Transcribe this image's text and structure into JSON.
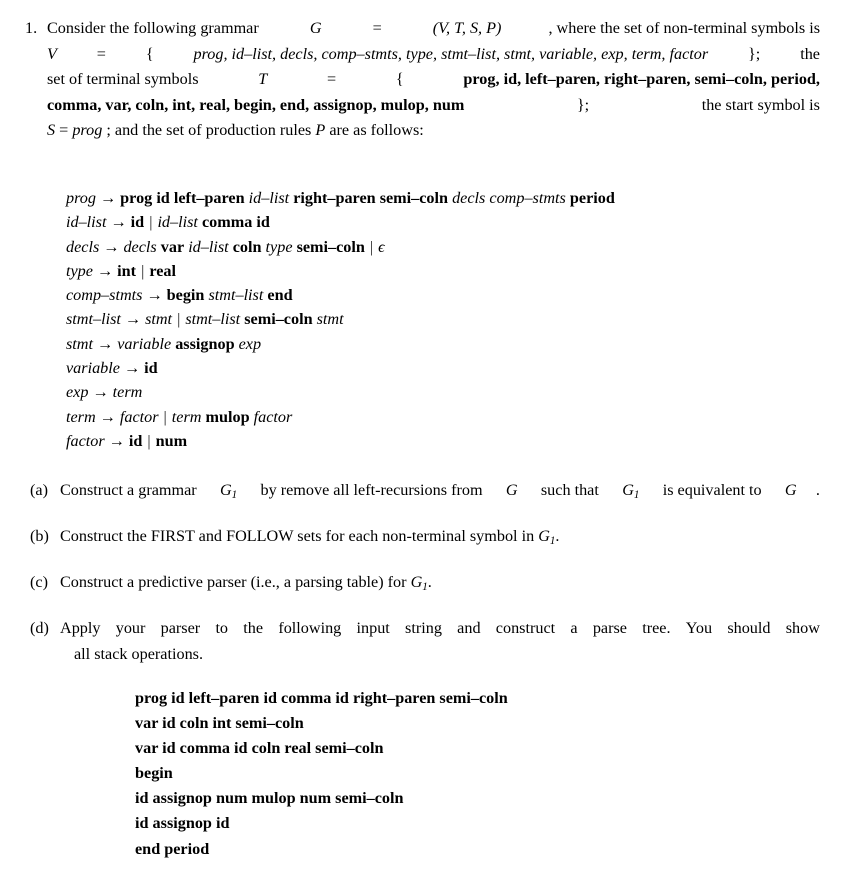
{
  "document": {
    "type": "homework-problem",
    "background_color": "#ffffff",
    "text_color": "#000000"
  },
  "problem": {
    "number": "1.",
    "intro_lines": [
      {
        "segments": [
          "Consider the following grammar ",
          "G",
          " = ",
          "(V, T, S, P)",
          ", where the set of non-terminal symbols is"
        ],
        "plain": "Consider the following grammar G = (V,T,S,P), where the set of non-terminal symbols is"
      },
      {
        "plain": "V = {prog, id_list, decls, comp_stmts, type, stmt_list, stmt, variable, exp, term, factor};  the"
      },
      {
        "plain": "set of terminal symbols T = { prog, id, left_paren, right_paren, semi_coln, period,"
      },
      {
        "plain": "comma, var, coln, int, real, begin, end, assignop, mulop, num }; the start symbol is"
      },
      {
        "plain": "S = prog; and the set of production rules P are as follows:"
      }
    ],
    "line1": {
      "a": "Consider the following grammar ",
      "G": "G",
      "eq": " = ",
      "tuple": "(V, T, S, P)",
      "b": ", where the set of non-terminal symbols is"
    },
    "line2": {
      "V": "V",
      "eq": "=",
      "open": "{",
      "nonterminals": [
        "prog",
        "id–list",
        "decls",
        "comp–stmts",
        "type",
        "stmt–list",
        "stmt",
        "variable",
        "exp",
        "term",
        "factor"
      ],
      "close": "};",
      "tail": "the"
    },
    "line3": {
      "lead": "set of terminal symbols ",
      "T": "T",
      "eq": " = ",
      "open": "{ ",
      "terminals_part1": "prog, id, left–paren, right–paren, semi–coln, period,"
    },
    "line4": {
      "terminals_part2": "comma, var, coln, int, real, begin, end, assignop, mulop, num",
      "close": " };",
      "tail": " the start symbol is"
    },
    "line5": {
      "S": "S",
      "eq": " = ",
      "prog": "prog",
      "tail": "; and the set of production rules ",
      "P": "P",
      "end": " are as follows:"
    }
  },
  "terminal_symbols": [
    "prog",
    "id",
    "left_paren",
    "right_paren",
    "semi_coln",
    "period",
    "comma",
    "var",
    "coln",
    "int",
    "real",
    "begin",
    "end",
    "assignop",
    "mulop",
    "num"
  ],
  "nonterminal_symbols": [
    "prog",
    "id_list",
    "decls",
    "comp_stmts",
    "type",
    "stmt_list",
    "stmt",
    "variable",
    "exp",
    "term",
    "factor"
  ],
  "start_symbol": "prog",
  "productions": [
    {
      "lhs": "prog",
      "arrow": "→",
      "rhs_plain": "prog id left_paren id_list right_paren semi_coln decls comp_stmts period",
      "tokens": [
        {
          "t": "prog",
          "k": "terminal"
        },
        {
          "t": "id",
          "k": "terminal"
        },
        {
          "t": "left–paren",
          "k": "terminal"
        },
        {
          "t": "id–list",
          "k": "nonterminal"
        },
        {
          "t": "right–paren",
          "k": "terminal"
        },
        {
          "t": "semi–coln",
          "k": "terminal"
        },
        {
          "t": "decls",
          "k": "nonterminal"
        },
        {
          "t": "comp–stmts",
          "k": "nonterminal"
        },
        {
          "t": "period",
          "k": "terminal"
        }
      ]
    },
    {
      "lhs": "id_list",
      "arrow": "→",
      "rhs_plain": "id | id_list comma id",
      "tokens": [
        {
          "t": "id",
          "k": "terminal"
        },
        {
          "t": "|",
          "k": "alt"
        },
        {
          "t": "id–list",
          "k": "nonterminal"
        },
        {
          "t": "comma",
          "k": "terminal"
        },
        {
          "t": "id",
          "k": "terminal"
        }
      ]
    },
    {
      "lhs": "decls",
      "arrow": "→",
      "rhs_plain": "decls var id_list coln type semi_coln | ϵ",
      "tokens": [
        {
          "t": "decls",
          "k": "nonterminal"
        },
        {
          "t": "var",
          "k": "terminal"
        },
        {
          "t": "id–list",
          "k": "nonterminal"
        },
        {
          "t": "coln",
          "k": "terminal"
        },
        {
          "t": "type",
          "k": "nonterminal"
        },
        {
          "t": "semi–coln",
          "k": "terminal"
        },
        {
          "t": "|",
          "k": "alt"
        },
        {
          "t": "ϵ",
          "k": "epsilon"
        }
      ]
    },
    {
      "lhs": "type",
      "arrow": "→",
      "rhs_plain": "int | real",
      "tokens": [
        {
          "t": "int",
          "k": "terminal"
        },
        {
          "t": "|",
          "k": "alt"
        },
        {
          "t": "real",
          "k": "terminal"
        }
      ]
    },
    {
      "lhs": "comp_stmts",
      "arrow": "→",
      "rhs_plain": "begin stmt_list end",
      "tokens": [
        {
          "t": "begin",
          "k": "terminal"
        },
        {
          "t": "stmt–list",
          "k": "nonterminal"
        },
        {
          "t": "end",
          "k": "terminal"
        }
      ]
    },
    {
      "lhs": "stmt_list",
      "arrow": "→",
      "rhs_plain": "stmt | stmt_list semi_coln stmt",
      "tokens": [
        {
          "t": "stmt",
          "k": "nonterminal"
        },
        {
          "t": "|",
          "k": "alt"
        },
        {
          "t": "stmt–list",
          "k": "nonterminal"
        },
        {
          "t": "semi–coln",
          "k": "terminal"
        },
        {
          "t": "stmt",
          "k": "nonterminal"
        }
      ]
    },
    {
      "lhs": "stmt",
      "arrow": "→",
      "rhs_plain": "variable assignop exp",
      "tokens": [
        {
          "t": "variable",
          "k": "nonterminal"
        },
        {
          "t": "assignop",
          "k": "terminal"
        },
        {
          "t": "exp",
          "k": "nonterminal"
        }
      ]
    },
    {
      "lhs": "variable",
      "arrow": "→",
      "rhs_plain": "id",
      "tokens": [
        {
          "t": "id",
          "k": "terminal"
        }
      ]
    },
    {
      "lhs": "exp",
      "arrow": "→",
      "rhs_plain": "term",
      "tokens": [
        {
          "t": "term",
          "k": "nonterminal"
        }
      ]
    },
    {
      "lhs": "term",
      "arrow": "→",
      "rhs_plain": "factor | term mulop factor",
      "tokens": [
        {
          "t": "factor",
          "k": "nonterminal"
        },
        {
          "t": "|",
          "k": "alt"
        },
        {
          "t": "term",
          "k": "nonterminal"
        },
        {
          "t": "mulop",
          "k": "terminal"
        },
        {
          "t": "factor",
          "k": "nonterminal"
        }
      ]
    },
    {
      "lhs": "factor",
      "arrow": "→",
      "rhs_plain": "id | num",
      "tokens": [
        {
          "t": "id",
          "k": "terminal"
        },
        {
          "t": "|",
          "k": "alt"
        },
        {
          "t": "num",
          "k": "terminal"
        }
      ]
    }
  ],
  "subitems": [
    {
      "tag": "(a)",
      "line1_left": "Construct a grammar ",
      "sym1": "G",
      "sub1": "1",
      "mid": " by remove all left-recursions from ",
      "sym2": "G",
      "mid2": " such that ",
      "sym3": "G",
      "sub3": "1",
      "tail": " is equivalent to ",
      "sym4": "G",
      "period": ".",
      "plain": "Construct a grammar G1 by remove all left-recursions from G such that G1 is equivalent to G."
    },
    {
      "tag": "(b)",
      "lead": "Construct the FIRST and FOLLOW sets for each non-terminal symbol in ",
      "sym": "G",
      "sub": "1",
      "period": ".",
      "plain": "Construct the FIRST and FOLLOW sets for each non-terminal symbol in G1."
    },
    {
      "tag": "(c)",
      "lead": "Construct a predictive parser (i.e., a parsing table) for ",
      "sym": "G",
      "sub": "1",
      "period": ".",
      "plain": "Construct a predictive parser (i.e., a parsing table) for G1."
    },
    {
      "tag": "(d)",
      "line1": "Apply your parser to the following input string and construct a parse tree.  You should show",
      "line2": "all stack operations.",
      "plain": "Apply your parser to the following input string and construct a parse tree. You should show all stack operations."
    }
  ],
  "input_string": {
    "lines": [
      "prog id left–paren id comma id right–paren semi–coln",
      "var id coln int semi–coln",
      "var id comma id coln real semi–coln",
      "begin",
      "id assignop num mulop num semi–coln",
      "id assignop id",
      "end period"
    ]
  }
}
